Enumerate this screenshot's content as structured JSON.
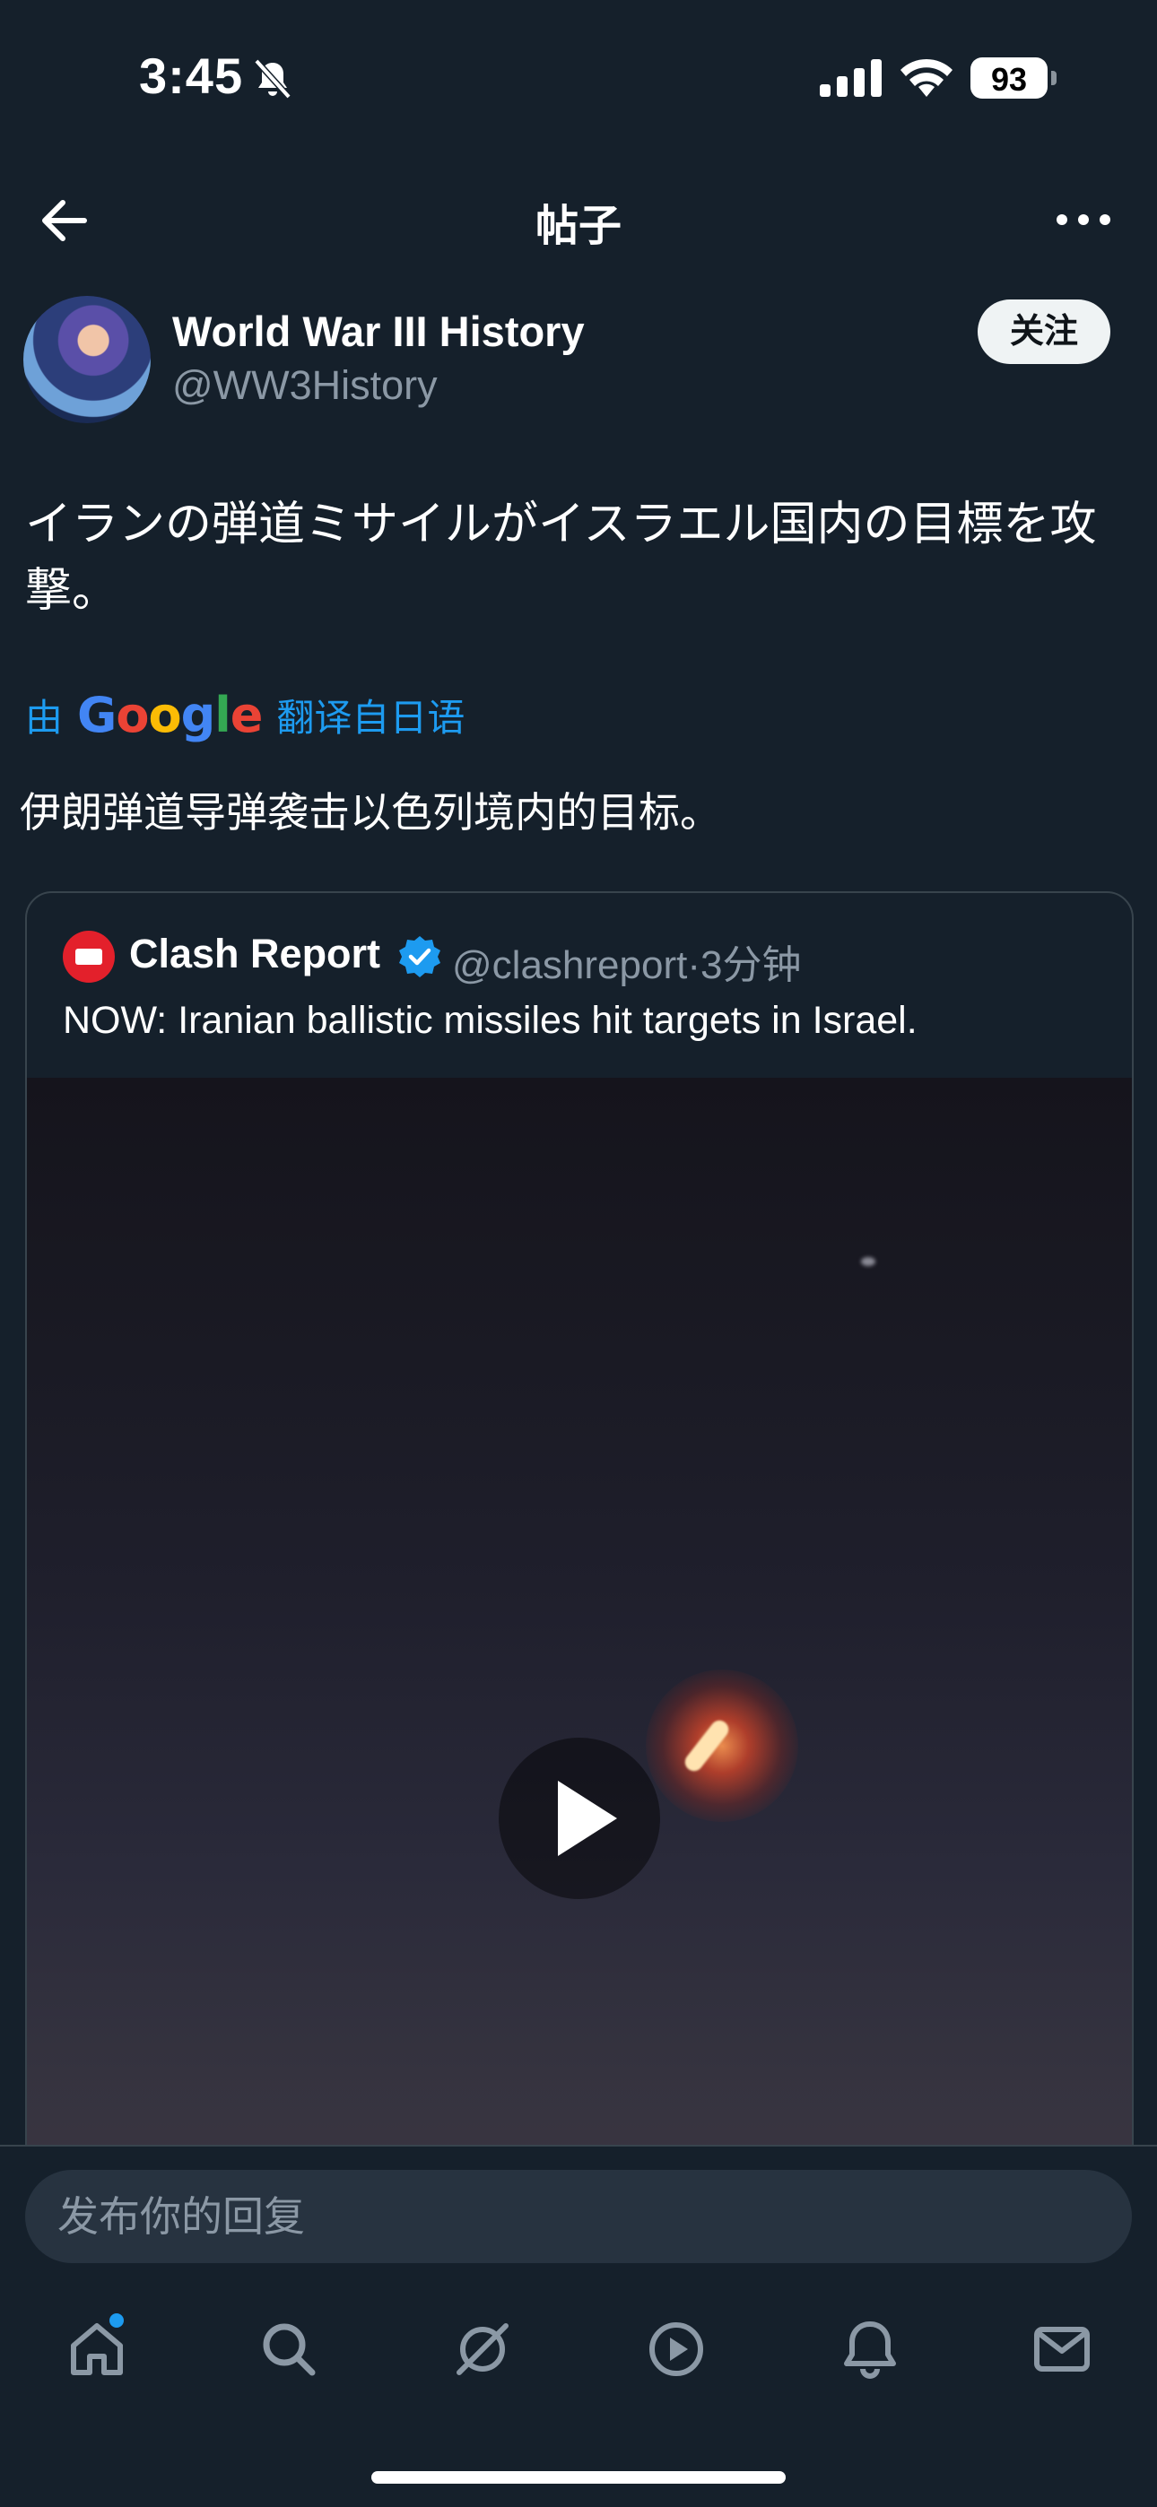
{
  "status_bar": {
    "time": "3:45",
    "battery": "93"
  },
  "header": {
    "title": "帖子"
  },
  "post": {
    "author_name": "World War III History",
    "author_handle": "@WW3History",
    "follow_label": "关注",
    "text": "イランの弾道ミサイルがイスラエル国内の目標を攻撃。",
    "translate_prefix": "由",
    "translate_brand": "Google",
    "translate_suffix": "翻译自日语",
    "translated_text": "伊朗弹道导弹袭击以色列境内的目标。"
  },
  "quote": {
    "author_name": "Clash Report",
    "author_handle": "@clashreport·3分钟",
    "text": "NOW: Iranian ballistic missiles hit targets in Israel."
  },
  "reply": {
    "placeholder": "发布你的回复"
  },
  "tabs": [
    "home-icon",
    "search-icon",
    "grok-icon",
    "video-icon",
    "bell-icon",
    "mail-icon"
  ],
  "colors": {
    "background": "#15202b",
    "accent": "#1d9bf0",
    "muted": "#8b98a5"
  }
}
